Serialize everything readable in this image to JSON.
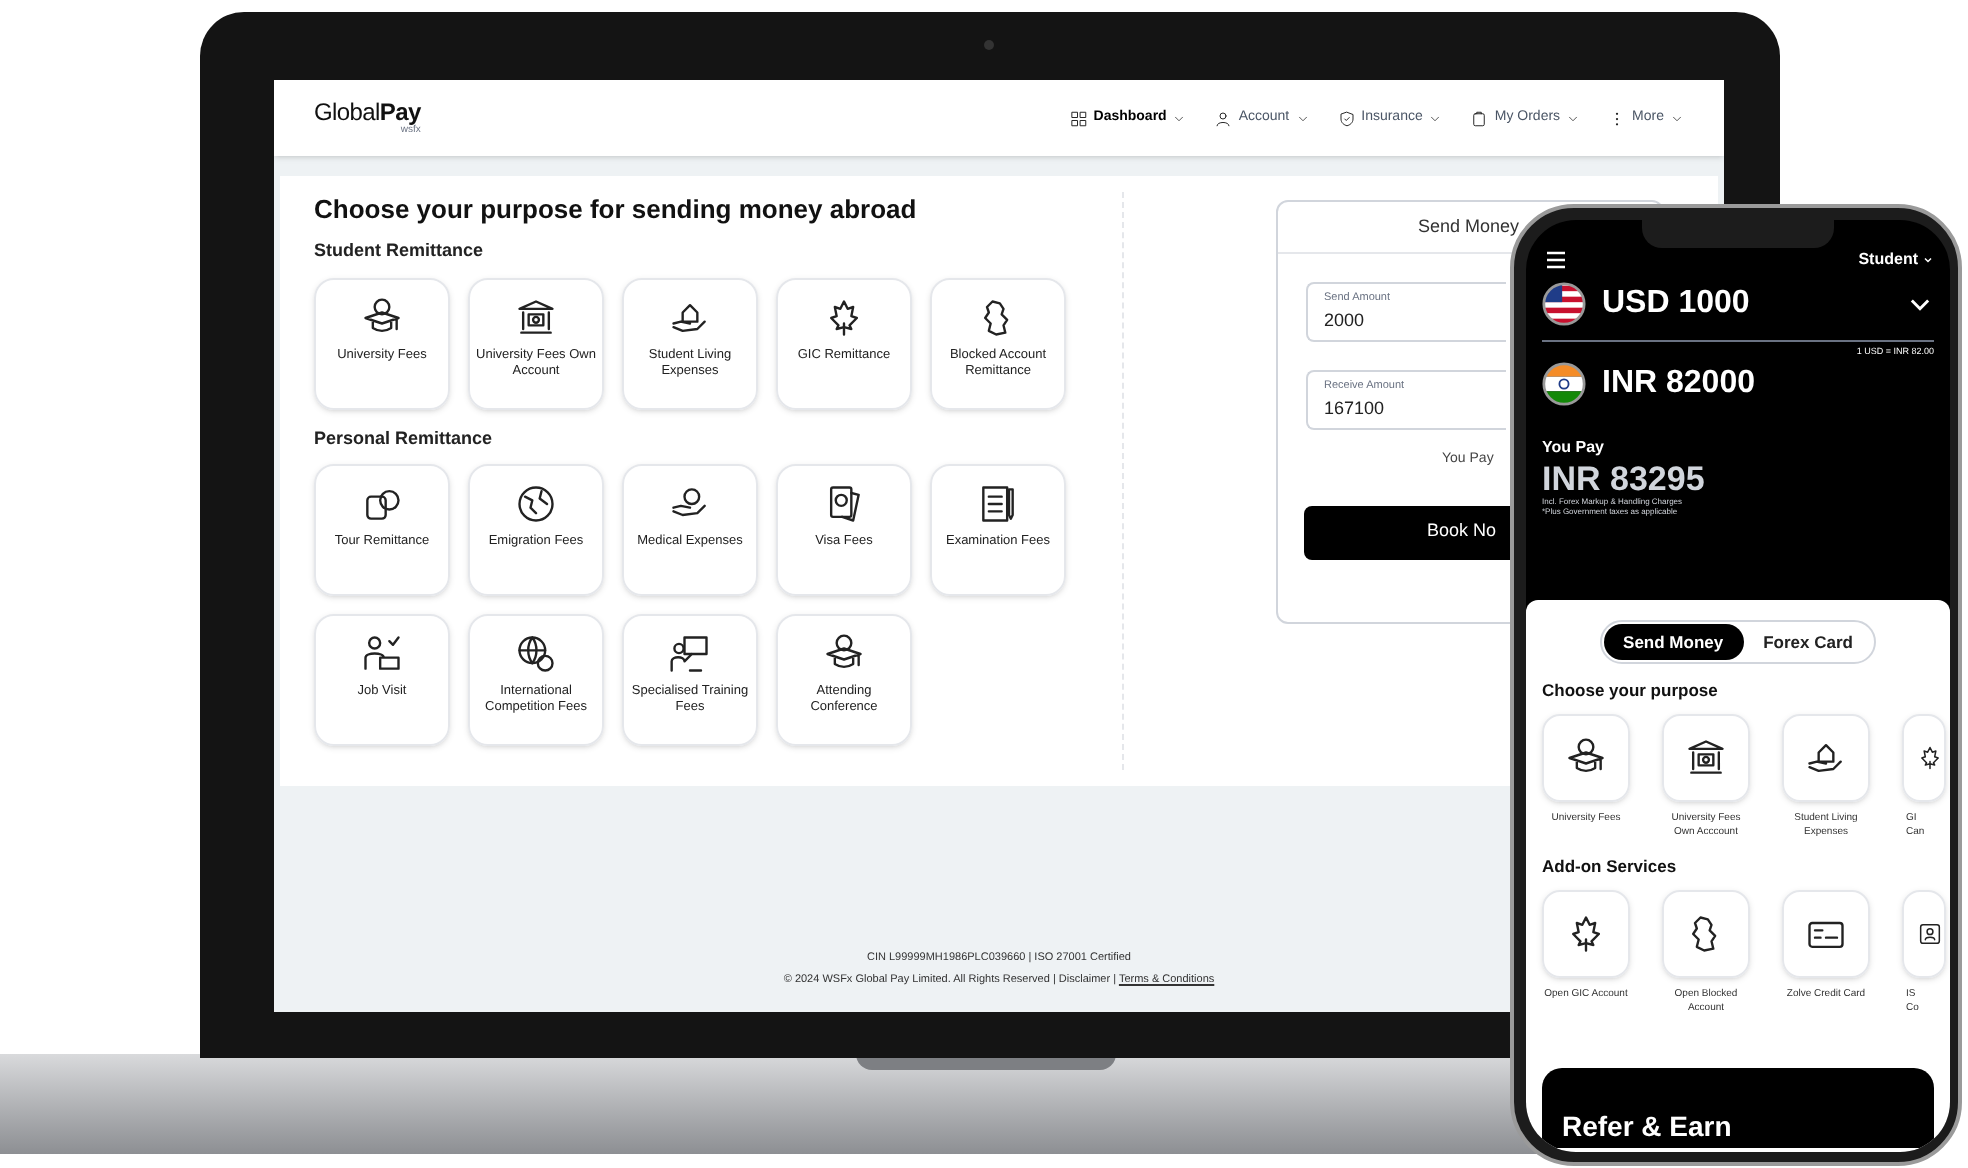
{
  "laptop": {
    "logo": "Global**Pay**",
    "logo_sub": "wsfx",
    "menu": [
      {
        "label": "Dashboard",
        "selected": true
      },
      {
        "label": "Account",
        "selected": false
      },
      {
        "label": "Insurance",
        "selected": false
      },
      {
        "label": "My Orders",
        "selected": false
      },
      {
        "label": "More",
        "selected": false
      }
    ],
    "heading": "Choose your purpose for sending money abroad",
    "sections": [
      {
        "title": "Student Remittance",
        "tiles": [
          "University Fees",
          "University Fees Own Account",
          "Student Living Expenses",
          "GIC Remittance",
          "Blocked Account Remittance"
        ]
      },
      {
        "title": "Personal Remittance",
        "tiles": [
          "Tour Remittance",
          "Emigration Fees",
          "Medical Expenses",
          "Visa Fees",
          "Examination Fees",
          "Job Visit",
          "International Competition Fees",
          "Specialised Training Fees",
          "Attending Conference"
        ]
      }
    ],
    "send_card": {
      "title": "Send Money",
      "fields": [
        {
          "label": "Send Amount",
          "value": "2000"
        },
        {
          "label": "Receive Amount",
          "value": "167100"
        }
      ],
      "you_pay": "You Pay",
      "button": "Book No"
    },
    "footer": {
      "line1": "CIN L99999MH1986PLC039660 | ISO 27001 Certified",
      "line2": "© 2024 WSFx Global Pay Limited. All Rights Reserved | Disclaimer | ",
      "link": "Terms & Conditions"
    }
  },
  "phone": {
    "profile": "Student",
    "from": "USD 1000",
    "rate": "1 USD = INR 82.00",
    "to": "INR 82000",
    "you_pay_label": "You Pay",
    "you_pay": "INR 83295",
    "notes": [
      "Incl. Forex Markup & Handling Charges",
      "*Plus Government taxes as applicable"
    ],
    "tabs": [
      {
        "label": "Send Money",
        "selected": true
      },
      {
        "label": "Forex Card",
        "selected": false
      }
    ],
    "sections": [
      {
        "title": "Choose your purpose",
        "tiles": [
          "University Fees",
          "University Fees Own Acccount",
          "Student Living Expenses",
          "GI Can"
        ]
      },
      {
        "title": "Add-on Services",
        "tiles": [
          "Open GIC Account",
          "Open Blocked Account",
          "Zolve Credit Card",
          "IS Co"
        ]
      }
    ],
    "banner": "Refer & Earn"
  }
}
